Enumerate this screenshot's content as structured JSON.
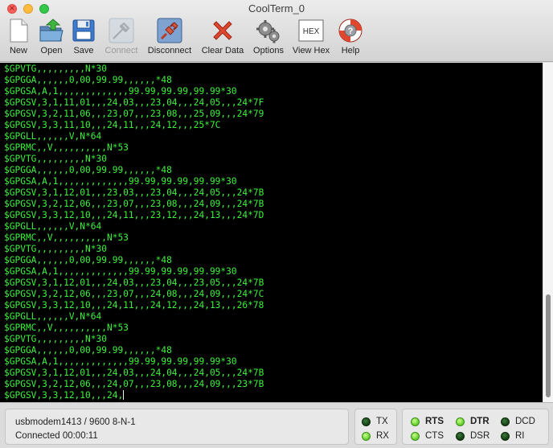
{
  "window": {
    "title": "CoolTerm_0"
  },
  "toolbar": {
    "new": "New",
    "open": "Open",
    "save": "Save",
    "connect": "Connect",
    "disconnect": "Disconnect",
    "clear_data": "Clear Data",
    "options": "Options",
    "view_hex": "View Hex",
    "view_hex_icon_text": "HEX",
    "help": "Help"
  },
  "terminal": {
    "text_color": "#3cf23c",
    "lines": [
      "$GPVTG,,,,,,,,,N*30",
      "$GPGGA,,,,,,0,00,99.99,,,,,,*48",
      "$GPGSA,A,1,,,,,,,,,,,,,99.99,99.99,99.99*30",
      "$GPGSV,3,1,11,01,,,24,03,,,23,04,,,24,05,,,24*7F",
      "$GPGSV,3,2,11,06,,,23,07,,,23,08,,,25,09,,,24*79",
      "$GPGSV,3,3,11,10,,,24,11,,,24,12,,,25*7C",
      "$GPGLL,,,,,,V,N*64",
      "$GPRMC,,V,,,,,,,,,,N*53",
      "$GPVTG,,,,,,,,,N*30",
      "$GPGGA,,,,,,0,00,99.99,,,,,,*48",
      "$GPGSA,A,1,,,,,,,,,,,,,99.99,99.99,99.99*30",
      "$GPGSV,3,1,12,01,,,23,03,,,23,04,,,24,05,,,24*7B",
      "$GPGSV,3,2,12,06,,,23,07,,,23,08,,,24,09,,,24*7B",
      "$GPGSV,3,3,12,10,,,24,11,,,23,12,,,24,13,,,24*7D",
      "$GPGLL,,,,,,V,N*64",
      "$GPRMC,,V,,,,,,,,,,N*53",
      "$GPVTG,,,,,,,,,N*30",
      "$GPGGA,,,,,,0,00,99.99,,,,,,*48",
      "$GPGSA,A,1,,,,,,,,,,,,,99.99,99.99,99.99*30",
      "$GPGSV,3,1,12,01,,,24,03,,,23,04,,,23,05,,,24*7B",
      "$GPGSV,3,2,12,06,,,23,07,,,24,08,,,24,09,,,24*7C",
      "$GPGSV,3,3,12,10,,,24,11,,,24,12,,,24,13,,,26*78",
      "$GPGLL,,,,,,V,N*64",
      "$GPRMC,,V,,,,,,,,,,N*53",
      "$GPVTG,,,,,,,,,N*30",
      "$GPGGA,,,,,,0,00,99.99,,,,,,*48",
      "$GPGSA,A,1,,,,,,,,,,,,,99.99,99.99,99.99*30",
      "$GPGSV,3,1,12,01,,,24,03,,,24,04,,,24,05,,,24*7B",
      "$GPGSV,3,2,12,06,,,24,07,,,23,08,,,24,09,,,23*7B",
      "$GPGSV,3,3,12,10,,,24,"
    ]
  },
  "status": {
    "port_settings": "usbmodem1413 / 9600 8-N-1",
    "connection": "Connected 00:00:11",
    "indicators": {
      "tx": "TX",
      "rx": "RX",
      "rts": "RTS",
      "cts": "CTS",
      "dtr": "DTR",
      "dsr": "DSR",
      "dcd": "DCD",
      "ri": "RI"
    }
  }
}
